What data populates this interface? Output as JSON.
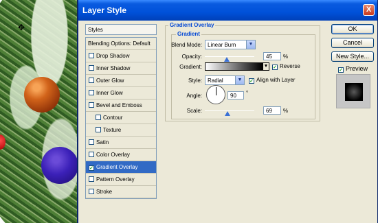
{
  "window": {
    "title": "Layer Style",
    "close_glyph": "X"
  },
  "styles_panel": {
    "header": "Styles",
    "items": [
      {
        "label": "Blending Options: Default",
        "has_checkbox": false,
        "checked": false,
        "indent": false,
        "selected": false
      },
      {
        "label": "Drop Shadow",
        "has_checkbox": true,
        "checked": false,
        "indent": false,
        "selected": false
      },
      {
        "label": "Inner Shadow",
        "has_checkbox": true,
        "checked": false,
        "indent": false,
        "selected": false
      },
      {
        "label": "Outer Glow",
        "has_checkbox": true,
        "checked": false,
        "indent": false,
        "selected": false
      },
      {
        "label": "Inner Glow",
        "has_checkbox": true,
        "checked": false,
        "indent": false,
        "selected": false
      },
      {
        "label": "Bevel and Emboss",
        "has_checkbox": true,
        "checked": false,
        "indent": false,
        "selected": false
      },
      {
        "label": "Contour",
        "has_checkbox": true,
        "checked": false,
        "indent": true,
        "selected": false
      },
      {
        "label": "Texture",
        "has_checkbox": true,
        "checked": false,
        "indent": true,
        "selected": false
      },
      {
        "label": "Satin",
        "has_checkbox": true,
        "checked": false,
        "indent": false,
        "selected": false
      },
      {
        "label": "Color Overlay",
        "has_checkbox": true,
        "checked": false,
        "indent": false,
        "selected": false
      },
      {
        "label": "Gradient Overlay",
        "has_checkbox": true,
        "checked": true,
        "indent": false,
        "selected": true
      },
      {
        "label": "Pattern Overlay",
        "has_checkbox": true,
        "checked": false,
        "indent": false,
        "selected": false
      },
      {
        "label": "Stroke",
        "has_checkbox": true,
        "checked": false,
        "indent": false,
        "selected": false
      }
    ]
  },
  "gradient_overlay": {
    "group_title": "Gradient Overlay",
    "subgroup_title": "Gradient",
    "blend_mode_label": "Blend Mode:",
    "blend_mode_value": "Linear Burn",
    "opacity_label": "Opacity:",
    "opacity_value": "45",
    "opacity_fraction": 0.45,
    "percent_unit": "%",
    "gradient_label": "Gradient:",
    "reverse_label": "Reverse",
    "reverse_checked": true,
    "style_label": "Style:",
    "style_value": "Radial",
    "align_label": "Align with Layer",
    "align_checked": true,
    "angle_label": "Angle:",
    "angle_value": "90",
    "degree_unit": "°",
    "scale_label": "Scale:",
    "scale_value": "69",
    "scale_fraction": 0.46
  },
  "buttons": {
    "ok": "OK",
    "cancel": "Cancel",
    "new_style": "New Style..."
  },
  "preview": {
    "label": "Preview",
    "checked": true
  },
  "cursor": {
    "icon": "move-cursor-icon",
    "glyph": "✥"
  },
  "colors": {
    "title_bar": "#0051d9",
    "selection": "#316ac5",
    "group_title": "#0046d5",
    "dialog_bg": "#ece9d8"
  }
}
